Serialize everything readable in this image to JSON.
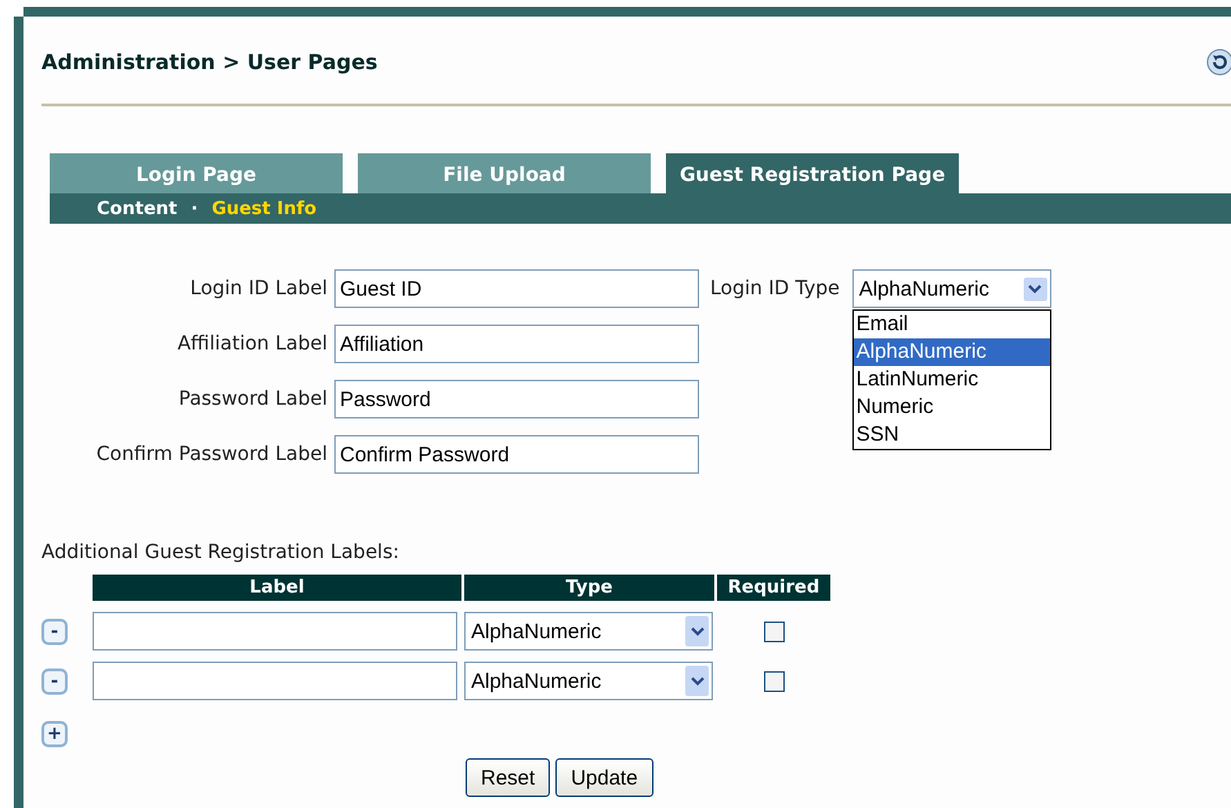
{
  "breadcrumb": {
    "section": "Administration",
    "separator": ">",
    "page": "User Pages"
  },
  "tabs": [
    {
      "label": "Login Page",
      "selected": false
    },
    {
      "label": "File Upload",
      "selected": false
    },
    {
      "label": "Guest Registration Page",
      "selected": true
    }
  ],
  "subtabs": [
    {
      "label": "Content",
      "selected": false
    },
    {
      "label": "Guest Info",
      "selected": true
    }
  ],
  "subtab_separator": "·",
  "fields": [
    {
      "label": "Login ID Label",
      "value": "Guest ID"
    },
    {
      "label": "Affiliation Label",
      "value": "Affiliation"
    },
    {
      "label": "Password Label",
      "value": "Password"
    },
    {
      "label": "Confirm Password Label",
      "value": "Confirm Password"
    }
  ],
  "login_id_type": {
    "label": "Login ID Type",
    "value": "AlphaNumeric",
    "expanded": true,
    "options": [
      {
        "label": "Email",
        "selected": false
      },
      {
        "label": "AlphaNumeric",
        "selected": true
      },
      {
        "label": "LatinNumeric",
        "selected": false
      },
      {
        "label": "Numeric",
        "selected": false
      },
      {
        "label": "SSN",
        "selected": false
      }
    ]
  },
  "additional": {
    "title": "Additional Guest Registration Labels:",
    "columns": [
      "Label",
      "Type",
      "Required"
    ],
    "rows": [
      {
        "remove": "-",
        "label": "",
        "type": "AlphaNumeric",
        "required": false
      },
      {
        "remove": "-",
        "label": "",
        "type": "AlphaNumeric",
        "required": false
      }
    ],
    "add": "+"
  },
  "buttons": [
    "Reset",
    "Update"
  ]
}
